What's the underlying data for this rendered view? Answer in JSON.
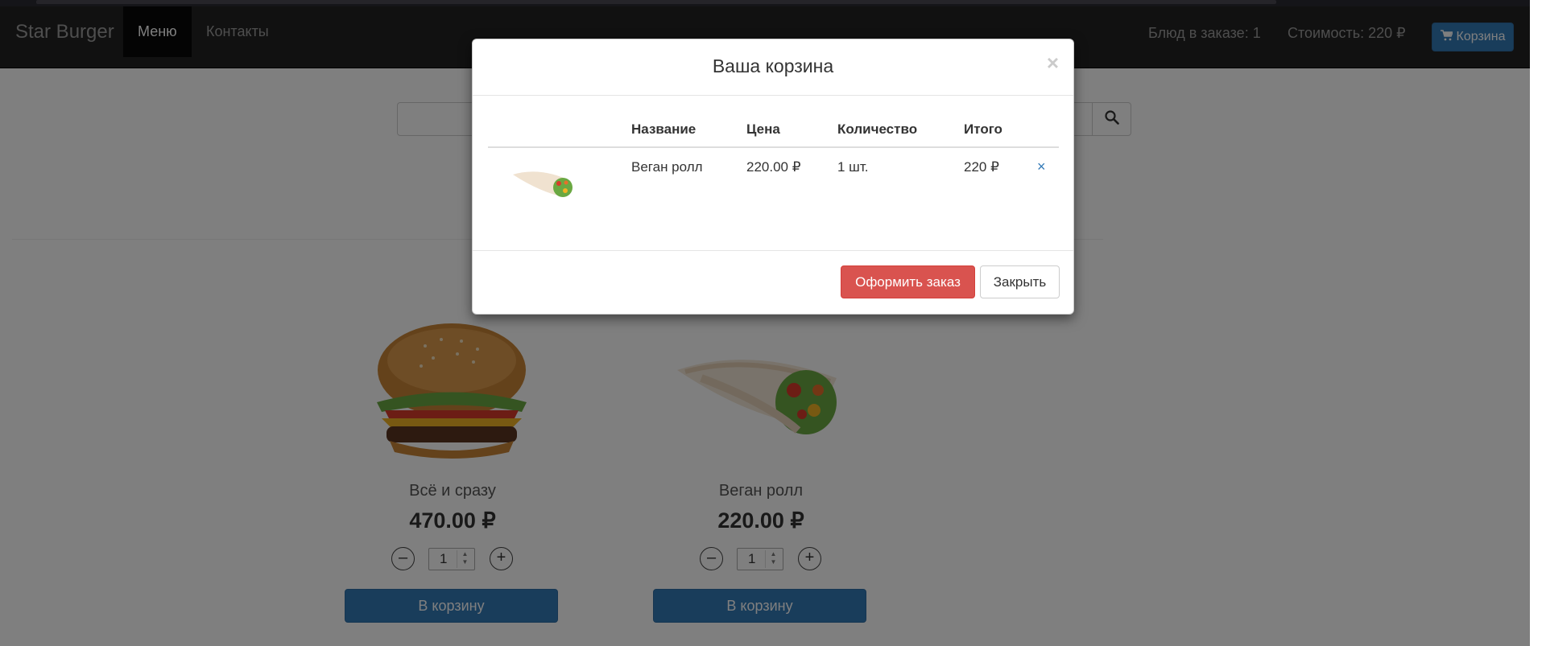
{
  "navbar": {
    "brand": "Star Burger",
    "items": [
      {
        "label": "Меню",
        "active": true
      },
      {
        "label": "Контакты",
        "active": false
      }
    ],
    "dishes_in_order": "Блюд в заказе: 1",
    "cost": "Стоимость: 220 ₽",
    "cart_label": "Корзина"
  },
  "products": [
    {
      "name": "Всё и сразу",
      "price": "470.00 ₽",
      "qty": "1",
      "add_label": "В корзину"
    },
    {
      "name": "Веган ролл",
      "price": "220.00 ₽",
      "qty": "1",
      "add_label": "В корзину"
    }
  ],
  "modal": {
    "title": "Ваша корзина",
    "close_symbol": "×",
    "columns": [
      "Название",
      "Цена",
      "Количество",
      "Итого"
    ],
    "rows": [
      {
        "name": "Веган ролл",
        "price": "220.00 ₽",
        "quantity": "1 шт.",
        "total": "220 ₽",
        "remove": "×"
      }
    ],
    "order_label": "Оформить заказ",
    "close_label": "Закрыть"
  },
  "colors": {
    "primary": "#337ab7",
    "danger": "#d9534f",
    "navbar": "#222222"
  },
  "icons": {
    "cart": "cart-icon",
    "search": "search-icon"
  }
}
